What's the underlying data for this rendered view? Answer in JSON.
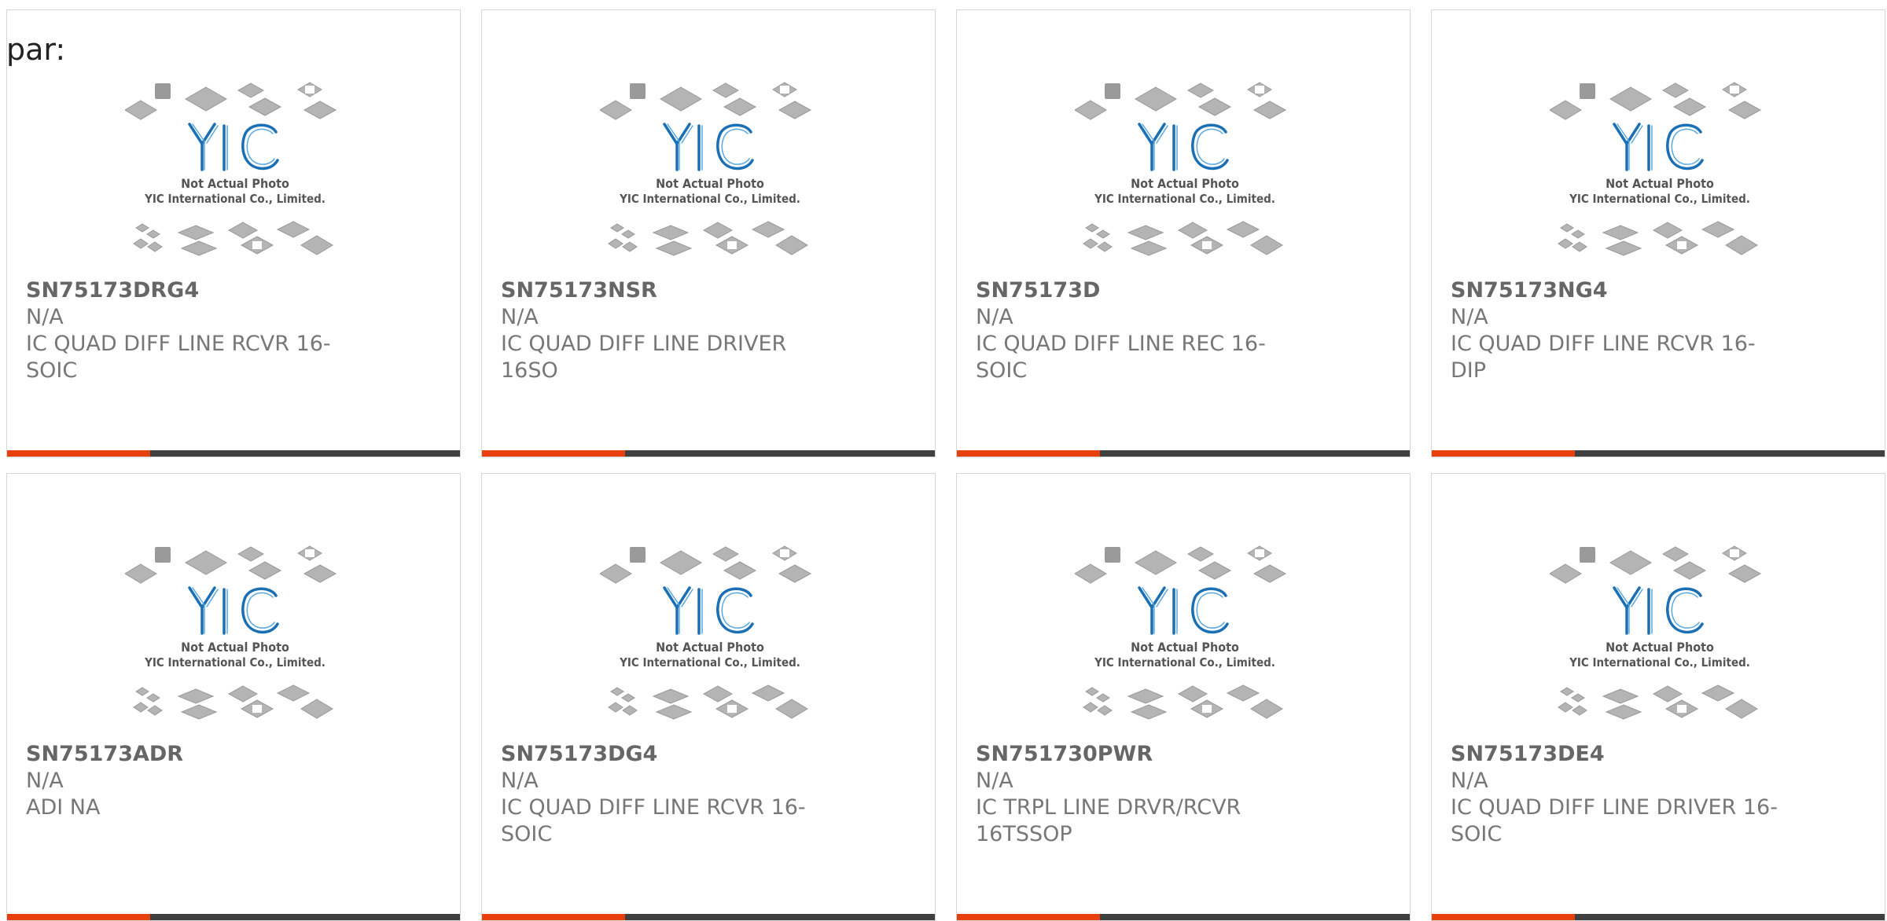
{
  "page_label": "par:",
  "placeholder": {
    "logo_text": "YIC",
    "line1": "Not Actual Photo",
    "line2": "YIC International Co., Limited."
  },
  "colors": {
    "accent": "#e8400c",
    "bar": "#404040",
    "logo": "#1a6fb5"
  },
  "products": [
    {
      "part": "SN75173DRG4",
      "brand": "N/A",
      "desc": "IC QUAD DIFF LINE RCVR 16-SOIC"
    },
    {
      "part": "SN75173NSR",
      "brand": "N/A",
      "desc": "IC QUAD DIFF LINE DRIVER 16SO"
    },
    {
      "part": "SN75173D",
      "brand": "N/A",
      "desc": "IC QUAD DIFF LINE REC 16-SOIC"
    },
    {
      "part": "SN75173NG4",
      "brand": "N/A",
      "desc": "IC QUAD DIFF LINE RCVR 16-DIP"
    },
    {
      "part": "SN75173ADR",
      "brand": "N/A",
      "desc": "ADI NA"
    },
    {
      "part": "SN75173DG4",
      "brand": "N/A",
      "desc": "IC QUAD DIFF LINE RCVR 16-SOIC"
    },
    {
      "part": "SN751730PWR",
      "brand": "N/A",
      "desc": "IC TRPL LINE DRVR/RCVR 16TSSOP"
    },
    {
      "part": "SN75173DE4",
      "brand": "N/A",
      "desc": "IC QUAD DIFF LINE DRIVER 16-SOIC"
    }
  ]
}
